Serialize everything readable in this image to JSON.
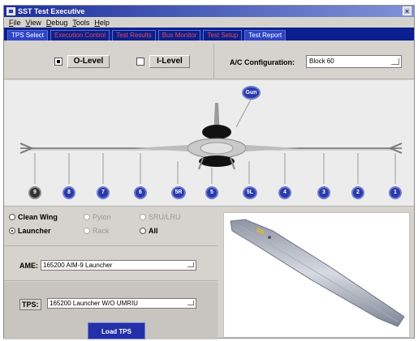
{
  "window": {
    "title": "SST Test Executive",
    "close_label": "×"
  },
  "menu": [
    "File",
    "View",
    "Debug",
    "Tools",
    "Help"
  ],
  "tabs": [
    {
      "label": "TPS Select",
      "state": "active"
    },
    {
      "label": "Execution Control",
      "state": "inactive"
    },
    {
      "label": "Test Results",
      "state": "inactive"
    },
    {
      "label": "Bus Monitor",
      "state": "inactive"
    },
    {
      "label": "Test Setup",
      "state": "inactive"
    },
    {
      "label": "Test Report",
      "state": "bright"
    }
  ],
  "levels": {
    "o_level": {
      "label": "O-Level",
      "checked": true
    },
    "i_level": {
      "label": "I-Level",
      "checked": false
    }
  },
  "ac_config": {
    "label": "A/C Configuration:",
    "value": "Block 60"
  },
  "aircraft": {
    "gun_label": "Gun",
    "stations": [
      "9",
      "8",
      "7",
      "6",
      "5R",
      "5",
      "5L",
      "4",
      "3",
      "2",
      "1"
    ]
  },
  "wing_config": {
    "options": [
      {
        "label": "Clean Wing",
        "selected": false,
        "enabled": true
      },
      {
        "label": "Pylon",
        "selected": false,
        "enabled": false
      },
      {
        "label": "SRU/LRU",
        "selected": false,
        "enabled": false
      },
      {
        "label": "Launcher",
        "selected": true,
        "enabled": true
      },
      {
        "label": "Rack",
        "selected": false,
        "enabled": false
      },
      {
        "label": "All",
        "selected": false,
        "enabled": true
      }
    ]
  },
  "ame": {
    "label": "AME:",
    "value": "165200 AIM-9 Launcher"
  },
  "tps": {
    "label": "TPS:",
    "value": "165200 Launcher W/O UMRIU",
    "load_label": "Load TPS"
  },
  "colors": {
    "title_blue": "#1c2f9c",
    "tab_bar": "#0c1f8f",
    "tab_inactive_text": "#e34d4d",
    "station_blue": "#2b3aa8",
    "panel_gray": "#d6d3ce"
  }
}
